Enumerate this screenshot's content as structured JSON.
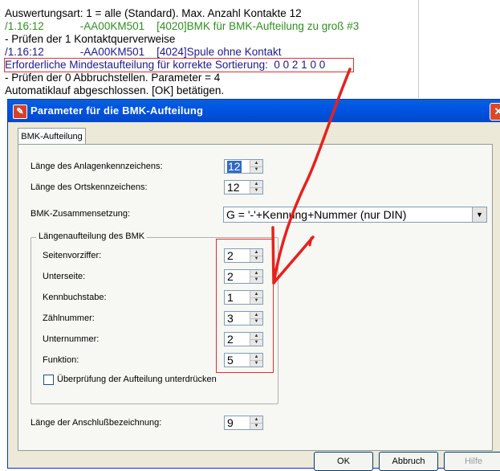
{
  "log": {
    "lines": [
      "Auswertungsart: 1 = alle (Standard). Max. Anzahl Kontakte 12",
      "/1.16:12            -AA00KM501    [4020]BMK für BMK-Aufteilung zu groß #3",
      "- Prüfen der 1 Kontaktquerverweise",
      "/1.16:12            -AA00KM501    [4024]Spule ohne Kontakt",
      "Erforderliche Mindestaufteilung für korrekte Sortierung:  0 0 2 1 0 0",
      "- Prüfen der 0 Abbruchstellen. Parameter = 4",
      "Automatiklauf abgeschlossen. [OK] betätigen."
    ]
  },
  "dialog": {
    "title": "Parameter für die BMK-Aufteilung",
    "close_icon": "close-icon",
    "tab_label": "BMK-Aufteilung",
    "fields": {
      "anlagen_label": "Länge des Anlagenkennzeichens:",
      "anlagen_value": "12",
      "orts_label": "Länge des Ortskennzeichens:",
      "orts_value": "12",
      "zusammensetzung_label": "BMK-Zusammensetzung:",
      "zusammensetzung_value": "G = '-'+Kennung+Nummer (nur DIN)",
      "anschluss_label": "Länge der Anschlußbezeichnung:",
      "anschluss_value": "9"
    },
    "group": {
      "title": "Längenaufteilung des BMK",
      "rows": [
        {
          "label": "Seitenvorziffer:",
          "value": "2"
        },
        {
          "label": "Unterseite:",
          "value": "2"
        },
        {
          "label": "Kennbuchstabe:",
          "value": "1"
        },
        {
          "label": "Zählnummer:",
          "value": "3"
        },
        {
          "label": "Unternummer:",
          "value": "2"
        },
        {
          "label": "Funktion:",
          "value": "5"
        }
      ],
      "checkbox_label": "Überprüfung der Aufteilung unterdrücken"
    },
    "buttons": {
      "ok": "OK",
      "cancel": "Abbruch",
      "help": "Hilfe"
    }
  },
  "colors": {
    "annotation_red": "#e03030",
    "title_blue": "#0055e5"
  }
}
